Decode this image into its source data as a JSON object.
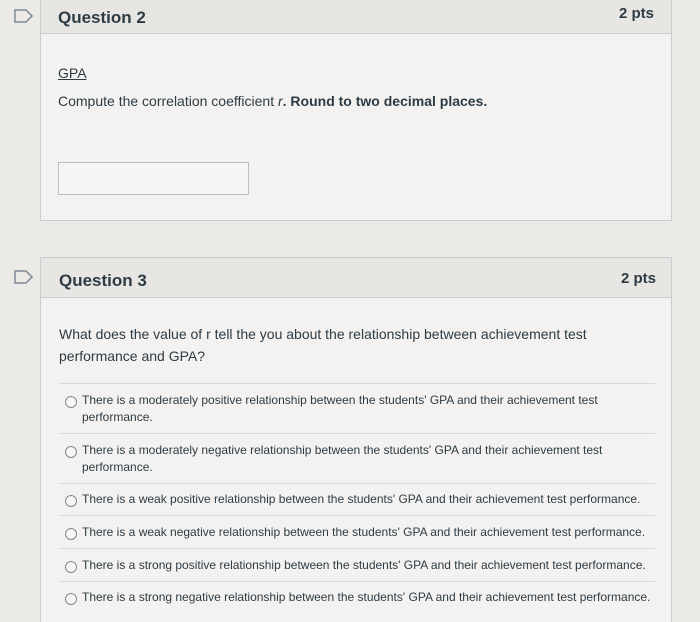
{
  "q2": {
    "title": "Question 2",
    "points": "2 pts",
    "link_text": "GPA",
    "prompt_plain": "Compute the correlation coefficient ",
    "prompt_var": "r",
    "prompt_bold": ". Round to two decimal places.",
    "answer_value": ""
  },
  "q3": {
    "title": "Question 3",
    "points": "2 pts",
    "prompt_line1": "What does the value of r tell the you about the relationship between achievement test",
    "prompt_line2": "performance and GPA?",
    "options": [
      {
        "line1": "There is a moderately positive relationship between the students' GPA and their achievement test",
        "line2": "performance."
      },
      {
        "line1": "There is a moderately negative relationship between the students' GPA and their achievement test",
        "line2": "performance."
      },
      {
        "line1": "There is a weak positive relationship between the students' GPA and their achievement test performance.",
        "line2": ""
      },
      {
        "line1": "There is a weak negative relationship between the students' GPA and their achievement test performance.",
        "line2": ""
      },
      {
        "line1": "There is a strong positive relationship between the students' GPA and their achievement test performance.",
        "line2": ""
      },
      {
        "line1": "There is a strong negative relationship between the students' GPA and their achievement test performance.",
        "line2": ""
      }
    ]
  },
  "colors": {
    "accent": "#2d3b45",
    "border": "#c7cdd1",
    "background": "#eceae7"
  }
}
